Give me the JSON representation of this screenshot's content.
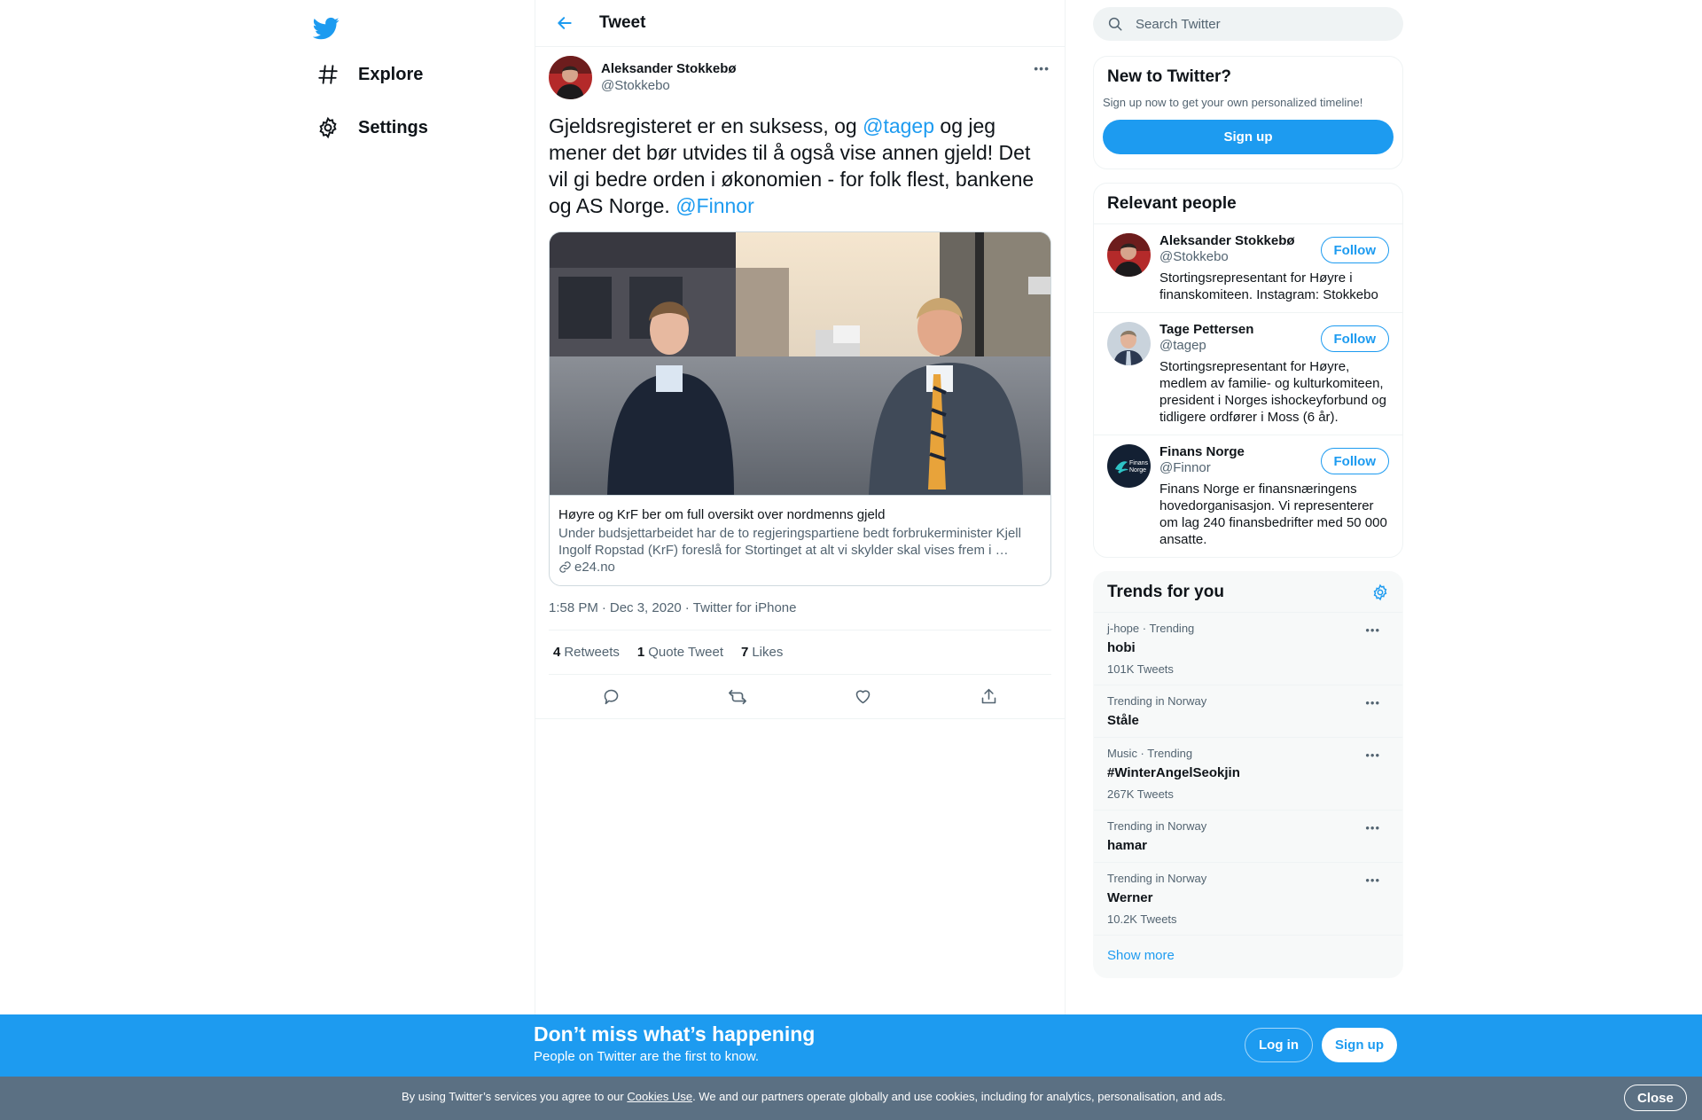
{
  "nav": {
    "logo_icon": "twitter-bird-icon",
    "items": [
      {
        "label": "Explore",
        "icon": "hashtag-icon"
      },
      {
        "label": "Settings",
        "icon": "gear-icon"
      }
    ]
  },
  "header": {
    "title": "Tweet",
    "back_icon": "arrow-left-icon"
  },
  "tweet": {
    "author_name": "Aleksander Stokkebø",
    "author_handle": "@Stokkebo",
    "text_parts": {
      "p1": "Gjeldsregisteret er en suksess, og ",
      "m1": "@tagep",
      "p2": " og jeg mener det bør utvides til å også vise annen gjeld! Det vil gi bedre orden i økonomien - for folk flest, bankene og AS Norge. ",
      "m2": "@Finnor"
    },
    "card": {
      "title": "Høyre og KrF ber om full oversikt over nordmenns gjeld",
      "description": "Under budsjettarbeidet har de to regjeringspartiene bedt forbrukerminister Kjell Ingolf Ropstad (KrF) foreslå for Stortinget at alt vi skylder skal vises frem i …",
      "domain": "e24.no"
    },
    "time": "1:58 PM",
    "date": "Dec 3, 2020",
    "source": "Twitter for iPhone",
    "stats": {
      "retweets": "4",
      "retweets_label": "Retweets",
      "quotes": "1",
      "quotes_label": "Quote Tweet",
      "likes": "7",
      "likes_label": "Likes"
    }
  },
  "search": {
    "placeholder": "Search Twitter"
  },
  "new_to_twitter": {
    "title": "New to Twitter?",
    "subtitle": "Sign up now to get your own personalized timeline!",
    "button": "Sign up"
  },
  "relevant_people": {
    "title": "Relevant people",
    "people": [
      {
        "name": "Aleksander Stokkebø",
        "handle": "@Stokkebo",
        "bio": "Stortingsrepresentant for Høyre i finanskomiteen. Instagram: Stokkebo",
        "follow": "Follow"
      },
      {
        "name": "Tage Pettersen",
        "handle": "@tagep",
        "bio": "Stortingsrepresentant for Høyre, medlem av familie- og kulturkomiteen, president i Norges ishockeyforbund og tidligere ordfører i Moss (6 år).",
        "follow": "Follow"
      },
      {
        "name": "Finans Norge",
        "handle": "@Finnor",
        "bio": "Finans Norge er finansnæringens hovedorganisasjon. Vi representerer om lag 240 finansbedrifter med 50 000 ansatte.",
        "follow": "Follow",
        "logo_text_1": "Finans",
        "logo_text_2": "Norge"
      }
    ]
  },
  "trends": {
    "title": "Trends for you",
    "items": [
      {
        "context": "j-hope · Trending",
        "name": "hobi",
        "count": "101K Tweets"
      },
      {
        "context": "Trending in Norway",
        "name": "Ståle",
        "count": ""
      },
      {
        "context": "Music · Trending",
        "name": "#WinterAngelSeokjin",
        "count": "267K Tweets"
      },
      {
        "context": "Trending in Norway",
        "name": "hamar",
        "count": ""
      },
      {
        "context": "Trending in Norway",
        "name": "Werner",
        "count": "10.2K Tweets"
      }
    ],
    "show_more": "Show more"
  },
  "bottom_bar": {
    "title": "Don’t miss what’s happening",
    "subtitle": "People on Twitter are the first to know.",
    "login": "Log in",
    "signup": "Sign up"
  },
  "cookie_bar": {
    "text_before": "By using Twitter’s services you agree to our ",
    "link": "Cookies Use",
    "text_after": ". We and our partners operate globally and use cookies, including for analytics, personalisation, and ads.",
    "close": "Close"
  },
  "colors": {
    "accent": "#1d9bf0",
    "text": "#0f1419",
    "muted": "#536471",
    "cookie_bg": "#5b7083"
  }
}
